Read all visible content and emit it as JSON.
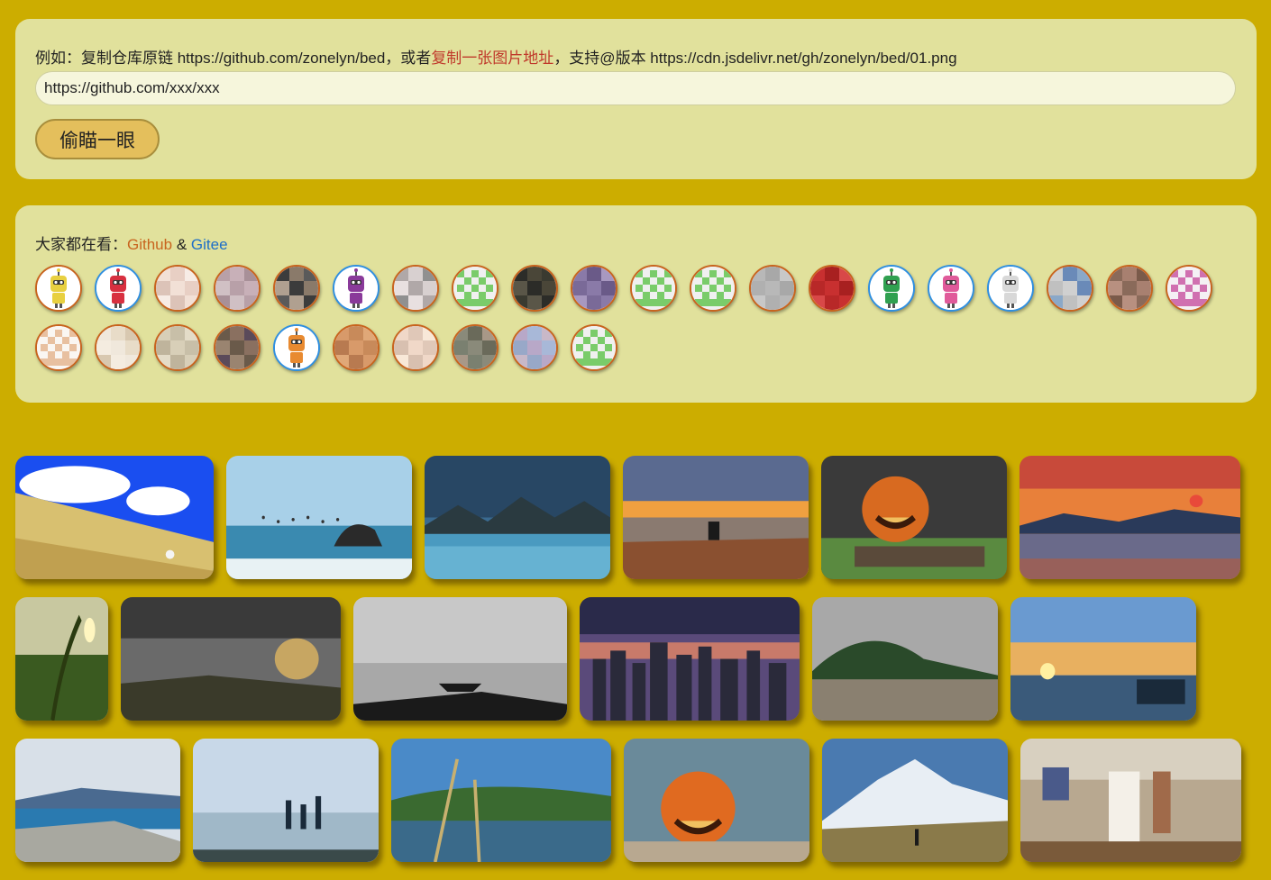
{
  "search": {
    "hint_prefix": "例如：复制仓库原链 https://github.com/zonelyn/bed，或者",
    "hint_link": "复制一张图片地址",
    "hint_suffix": "，支持@版本 https://cdn.jsdelivr.net/gh/zonelyn/bed/01.png",
    "input_value": "https://github.com/xxx/xxx",
    "button_label": "偷瞄一眼"
  },
  "watching": {
    "label": "大家都在看：",
    "github": "Github",
    "amp": "&",
    "gitee": "Gitee"
  },
  "colors": {
    "page_bg": "#ccad00",
    "card_bg": "#e1e19c",
    "hint_link": "#c0392b",
    "github_link": "#c8641e",
    "gitee_link": "#1e6fc8",
    "button_bg": "#e4bf5c"
  },
  "avatars": [
    {
      "type": "robot-yellow-avatar",
      "ring": "orange"
    },
    {
      "type": "robot-red-avatar",
      "ring": "blue"
    },
    {
      "type": "blurred-photo-avatar",
      "ring": "orange"
    },
    {
      "type": "blurred-photo-avatar",
      "ring": "orange"
    },
    {
      "type": "blurred-photo-avatar",
      "ring": "orange"
    },
    {
      "type": "robot-purple-avatar",
      "ring": "blue"
    },
    {
      "type": "blurred-photo-avatar",
      "ring": "orange"
    },
    {
      "type": "identicon-green-avatar",
      "ring": "orange"
    },
    {
      "type": "blurred-photo-avatar",
      "ring": "orange"
    },
    {
      "type": "blurred-photo-avatar",
      "ring": "orange"
    },
    {
      "type": "identicon-green-avatar",
      "ring": "orange"
    },
    {
      "type": "identicon-green-avatar",
      "ring": "orange"
    },
    {
      "type": "blurred-photo-avatar",
      "ring": "orange"
    },
    {
      "type": "blurred-photo-avatar",
      "ring": "orange"
    },
    {
      "type": "robot-green-avatar",
      "ring": "blue"
    },
    {
      "type": "robot-pink-avatar",
      "ring": "blue"
    },
    {
      "type": "robot-white-avatar",
      "ring": "blue"
    },
    {
      "type": "blurred-photo-avatar",
      "ring": "orange"
    },
    {
      "type": "blurred-photo-avatar",
      "ring": "orange"
    },
    {
      "type": "identicon-pink-avatar",
      "ring": "orange"
    },
    {
      "type": "identicon-peach-avatar",
      "ring": "orange"
    },
    {
      "type": "blurred-photo-avatar",
      "ring": "orange"
    },
    {
      "type": "blurred-photo-avatar",
      "ring": "orange"
    },
    {
      "type": "blurred-photo-avatar",
      "ring": "orange"
    },
    {
      "type": "robot-orange-avatar",
      "ring": "blue"
    },
    {
      "type": "blurred-photo-avatar",
      "ring": "orange"
    },
    {
      "type": "blurred-photo-avatar",
      "ring": "orange"
    },
    {
      "type": "blurred-photo-avatar",
      "ring": "orange"
    },
    {
      "type": "blurred-photo-avatar",
      "ring": "orange"
    },
    {
      "type": "identicon-green-avatar",
      "ring": "orange"
    }
  ],
  "photos": [
    "meadow-girl-photo",
    "sea-rock-birds-photo",
    "mountain-lake-dock-photo",
    "fishing-sunset-photo",
    "halloween-pumpkin-photo",
    "sunset-lake-boat-photo",
    "wheat-sun-photo",
    "stormy-coast-photo",
    "silhouette-boat-photo",
    "city-skyline-photo",
    "green-hill-beach-photo",
    "misty-sunrise-lake-photo",
    "fjord-cliff-photo",
    "beach-family-fishing-photo",
    "lake-reeds-photo",
    "pumpkin-closeup-photo",
    "snowy-mountain-hiker-photo",
    "artist-studio-photo"
  ]
}
